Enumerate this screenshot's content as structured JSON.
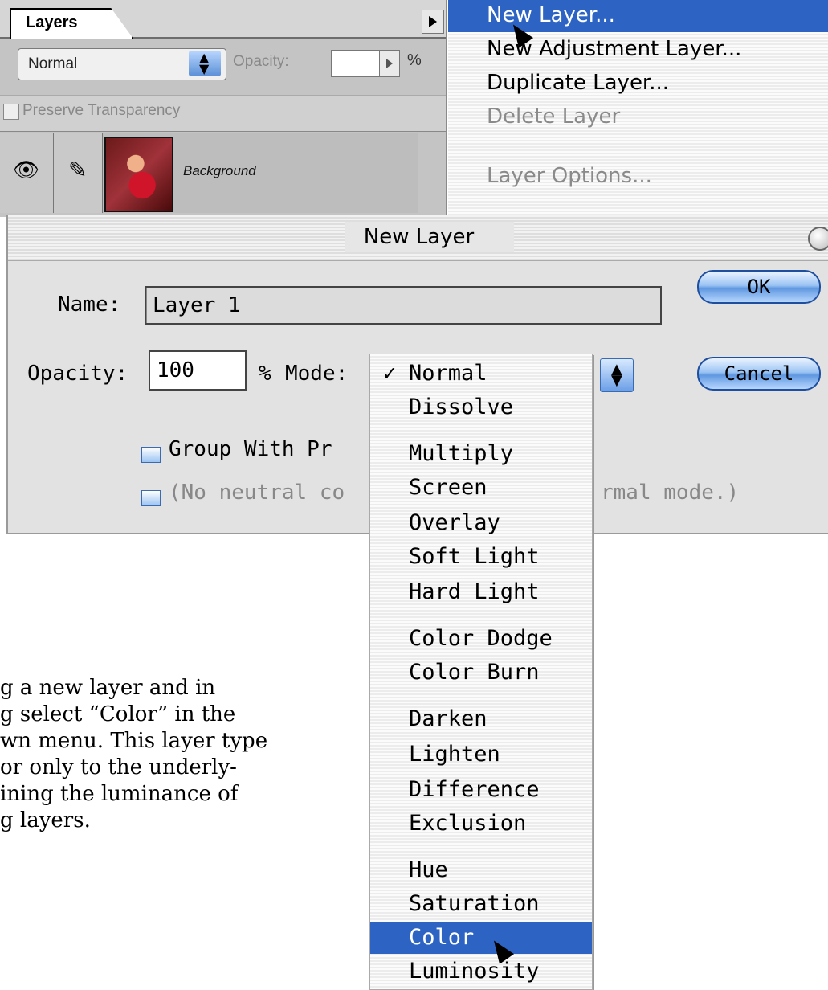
{
  "layers_palette": {
    "tab_label": "Layers",
    "blend_mode": "Normal",
    "opacity_label": "Opacity:",
    "opacity_value": "",
    "percent": "%",
    "preserve_label": "Preserve Transparency",
    "layer": {
      "name": "Background",
      "visible_icon": "eye-icon",
      "brush_icon": "brush-icon"
    }
  },
  "palette_menu": {
    "items": [
      {
        "label": "New Layer...",
        "highlighted": true
      },
      {
        "label": "New Adjustment Layer...",
        "highlighted": false
      },
      {
        "label": "Duplicate Layer...",
        "highlighted": false
      },
      {
        "label": "Delete Layer",
        "disabled": true
      },
      {
        "label": "Layer Options...",
        "disabled": true
      }
    ]
  },
  "dialog": {
    "title": "New Layer",
    "name_label": "Name:",
    "name_value": "Layer 1",
    "opacity_label": "Opacity:",
    "opacity_value": "100",
    "percent": "%",
    "mode_label": "Mode:",
    "ok_label": "OK",
    "cancel_label": "Cancel",
    "group_label": "Group With Pr",
    "neutral_label": "(No neutral co",
    "neutral_tail": "rmal mode.)"
  },
  "mode_menu": {
    "selected": "Color",
    "items": [
      "Normal",
      "Dissolve",
      "Multiply",
      "Screen",
      "Overlay",
      "Soft Light",
      "Hard Light",
      "Color Dodge",
      "Color Burn",
      "Darken",
      "Lighten",
      "Difference",
      "Exclusion",
      "Hue",
      "Saturation",
      "Color",
      "Luminosity"
    ],
    "checked": "Normal",
    "check_mark": "✓"
  },
  "body_text": {
    "lines": [
      "g a new layer and in",
      "g select “Color” in the",
      "wn menu. This layer type",
      "or only to the underly-",
      "ining the luminance of",
      "g layers."
    ]
  },
  "colors": {
    "highlight": "#2d64c4",
    "aqua": "#5f97e0"
  }
}
